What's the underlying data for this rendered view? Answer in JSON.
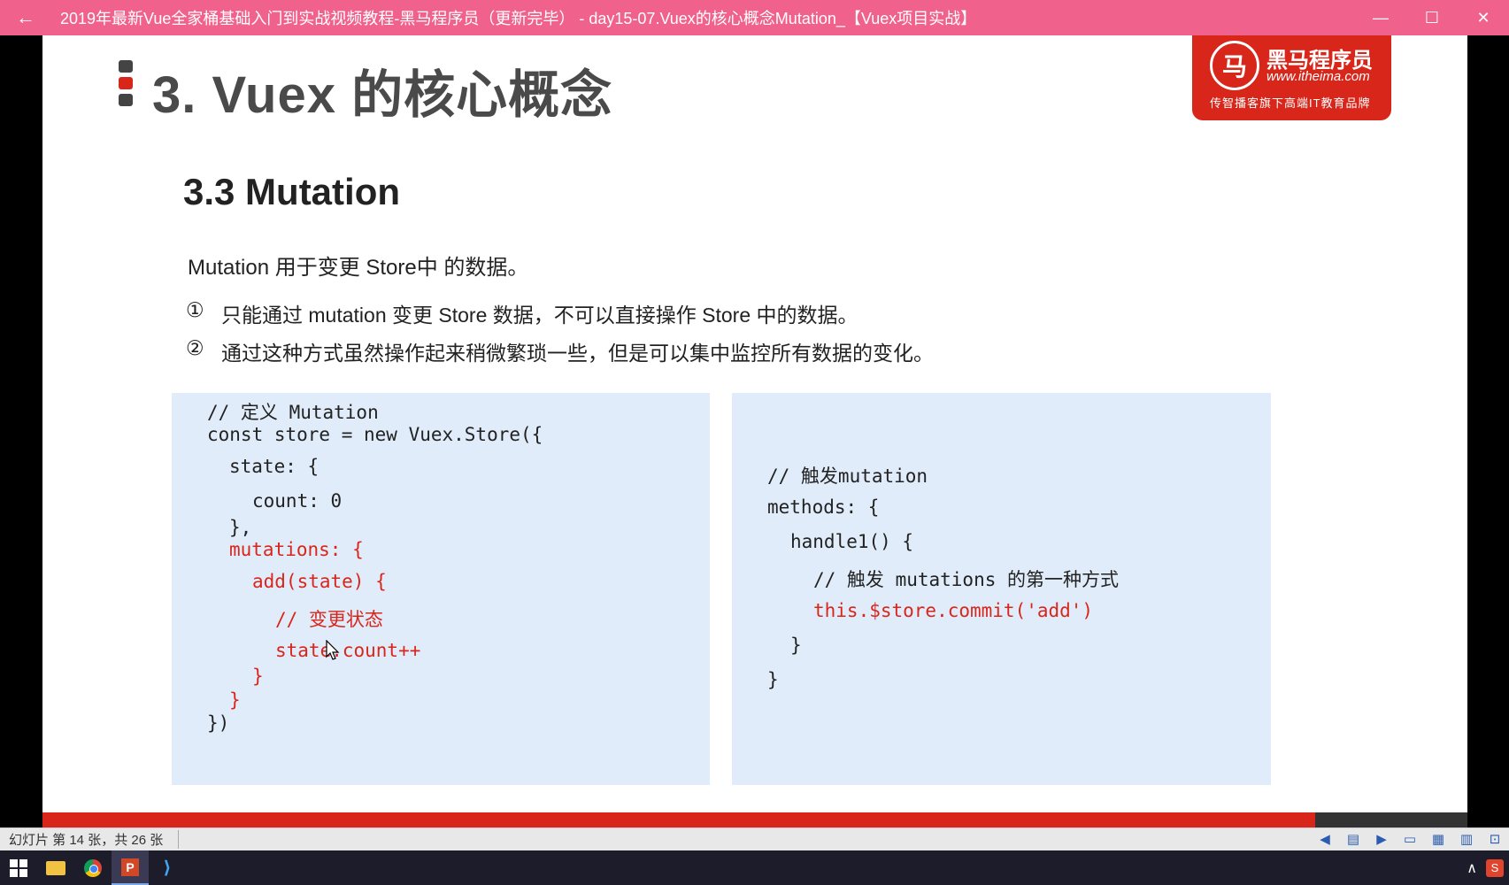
{
  "window": {
    "back_icon": "←",
    "title": "2019年最新Vue全家桶基础入门到实战视频教程-黑马程序员（更新完毕） - day15-07.Vuex的核心概念Mutation_【Vuex项目实战】",
    "minimize_icon": "—",
    "maximize_icon": "☐",
    "close_icon": "✕",
    "accent_color": "#f0628c"
  },
  "slide": {
    "title": "3. Vuex 的核心概念",
    "logo": {
      "mark": "马",
      "name": "黑马程序员",
      "url": "www.itheima.com",
      "slogan": "传智播客旗下高端IT教育品牌"
    },
    "section": "3.3 Mutation",
    "intro": "Mutation 用于变更 Store中 的数据。",
    "points": [
      {
        "num": "①",
        "text": "只能通过 mutation 变更 Store 数据，不可以直接操作 Store 中的数据。"
      },
      {
        "num": "②",
        "text": "通过这种方式虽然操作起来稍微繁琐一些，但是可以集中监控所有数据的变化。"
      }
    ],
    "code_left": [
      "// 定义 Mutation",
      "const store = new Vuex.Store({",
      "state: {",
      "count: 0",
      "},",
      "mutations: {",
      "add(state) {",
      "// 变更状态",
      "state.count++",
      "}",
      "}",
      "})"
    ],
    "code_right": [
      "// 触发mutation",
      "methods: {",
      "handle1() {",
      "// 触发 mutations 的第一种方式",
      "this.$store.commit('add')",
      "}",
      "}"
    ],
    "brand_red": "#d8261b"
  },
  "statusbar": {
    "slide_info": "幻灯片 第 14 张，共 26 张",
    "prev_icon": "◀",
    "notes_icon": "▤",
    "next_icon": "▶",
    "normal_view_icon": "▭",
    "sorter_view_icon": "▦",
    "reading_view_icon": "▥",
    "slideshow_icon": "⊡"
  },
  "taskbar": {
    "start_icon": "windows-icon",
    "apps": [
      "file-explorer",
      "chrome",
      "powerpoint",
      "vscode"
    ],
    "ppt_letter": "P",
    "tray_up_icon": "∧",
    "tray_app_letter": "S"
  }
}
